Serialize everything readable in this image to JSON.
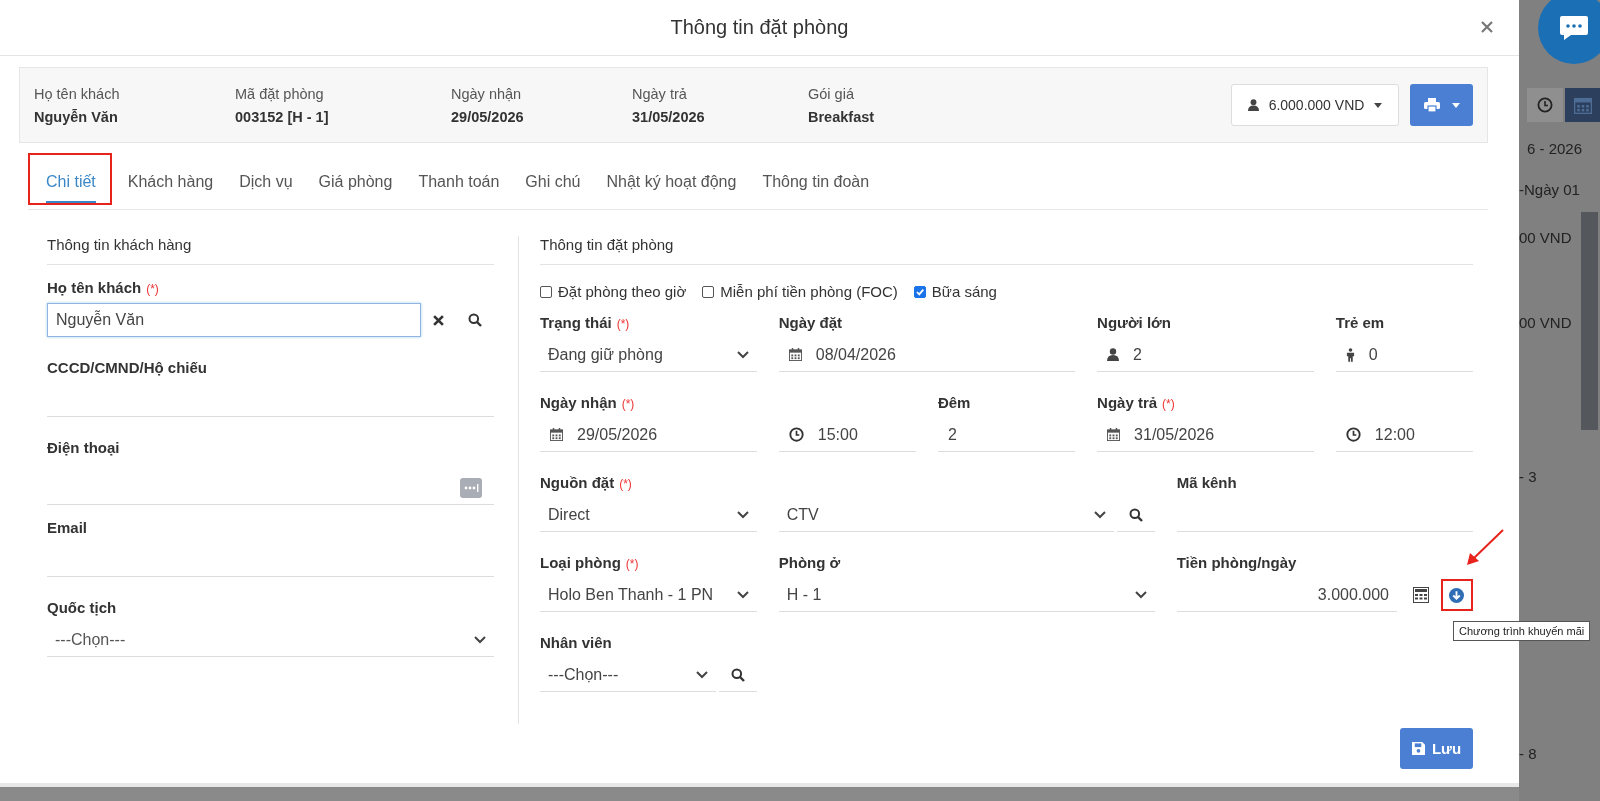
{
  "dialog": {
    "title": "Thông tin đặt phòng"
  },
  "summary": [
    {
      "label": "Họ tên khách",
      "value": "Nguyễn Văn"
    },
    {
      "label": "Mã đặt phòng",
      "value": "003152 [H - 1]"
    },
    {
      "label": "Ngày nhận",
      "value": "29/05/2026"
    },
    {
      "label": "Ngày trả",
      "value": "31/05/2026"
    },
    {
      "label": "Gói giá",
      "value": "Breakfast"
    }
  ],
  "total_button": {
    "label": "6.000.000 VND"
  },
  "tabs": [
    {
      "label": "Chi tiết",
      "selected": true,
      "annotated": true
    },
    {
      "label": "Khách hàng",
      "selected": false,
      "annotated": false
    },
    {
      "label": "Dịch vụ",
      "selected": false,
      "annotated": false
    },
    {
      "label": "Giá phòng",
      "selected": false,
      "annotated": false
    },
    {
      "label": "Thanh toán",
      "selected": false,
      "annotated": false
    },
    {
      "label": "Ghi chú",
      "selected": false,
      "annotated": false
    },
    {
      "label": "Nhật ký hoạt động",
      "selected": false,
      "annotated": false
    },
    {
      "label": "Thông tin đoàn",
      "selected": false,
      "annotated": false
    }
  ],
  "customer": {
    "title": "Thông tin khách hàng",
    "fields": [
      {
        "kind": "name",
        "label": "Họ tên khách",
        "mark": "(*)",
        "value": "Nguyễn Văn",
        "focused": true
      },
      {
        "kind": "text",
        "label": "CCCD/CMND/Hộ chiếu"
      },
      {
        "kind": "phone",
        "label": "Điện thoại"
      },
      {
        "kind": "text",
        "label": "Email"
      },
      {
        "kind": "select",
        "label": "Quốc tịch",
        "placeholder": "---Chọn---"
      }
    ]
  },
  "booking": {
    "title": "Thông tin đặt phòng",
    "options": [
      {
        "label": "Đặt phòng theo giờ",
        "checked": false
      },
      {
        "label": "Miễn phí tiền phòng (FOC)",
        "checked": false
      },
      {
        "label": "Bữa sáng",
        "checked": true
      }
    ],
    "fields": [
      {
        "kind": "select",
        "label": "Trạng thái",
        "mark": "(*)",
        "value": "Đang giữ phòng"
      },
      {
        "kind": "date",
        "label": "Ngày đặt",
        "value": "08/04/2026"
      },
      {
        "kind": "adults",
        "label": "Người lớn",
        "value": "2"
      },
      {
        "kind": "children",
        "label": "Trẻ em",
        "value": "0"
      },
      {
        "kind": "date",
        "label": "Ngày nhận",
        "mark": "(*)",
        "value": "29/05/2026"
      },
      {
        "kind": "time",
        "value": "15:00"
      },
      {
        "kind": "text",
        "label": "Đêm",
        "value": "2"
      },
      {
        "kind": "date",
        "label": "Ngày trả",
        "mark": "(*)",
        "value": "31/05/2026"
      },
      {
        "kind": "time",
        "value": "12:00"
      },
      {
        "kind": "select",
        "label": "Nguồn đặt",
        "mark": "(*)",
        "value": "Direct"
      },
      {
        "kind": "select-search",
        "value": "CTV"
      },
      {
        "kind": "text",
        "label": "Mã kênh"
      },
      {
        "kind": "select",
        "label": "Loại phòng",
        "mark": "(*)",
        "value": "Holo Ben Thanh - 1 PN"
      },
      {
        "kind": "select",
        "label": "Phòng ở",
        "value": "H - 1"
      },
      {
        "kind": "money",
        "label": "Tiền phòng/ngày",
        "value": "3.000.000",
        "annotated": true,
        "tooltip": "Chương trình khuyến mãi"
      },
      {
        "kind": "select-search",
        "label": "Nhân viên",
        "placeholder": "---Chọn---"
      }
    ]
  },
  "save_button": {
    "label": "Lưu"
  },
  "background": {
    "texts": [
      "6 - 2026",
      "-Ngày 01",
      "00 VND",
      "00 VND",
      "-   3",
      "-   8"
    ]
  }
}
